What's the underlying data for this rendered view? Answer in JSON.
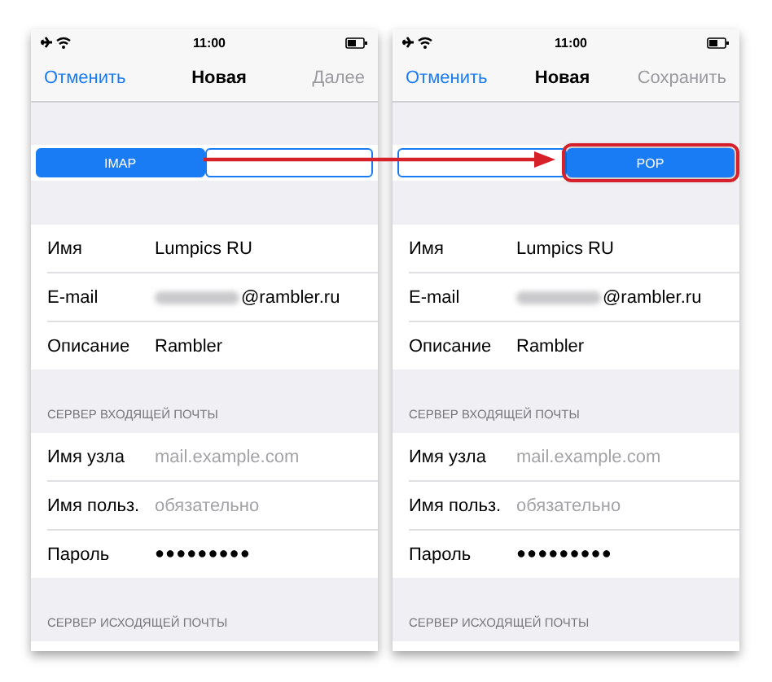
{
  "phones": [
    {
      "time": "11:00",
      "nav": {
        "cancel": "Отменить",
        "title": "Новая",
        "action": "Далее",
        "action_disabled": true
      },
      "segments": [
        {
          "label": "IMAP",
          "selected": true,
          "highlighted": false
        },
        {
          "selected": false,
          "highlighted": false
        }
      ],
      "account_rows": [
        {
          "kind": "text",
          "label": "Имя",
          "value": "Lumpics RU"
        },
        {
          "kind": "email",
          "label": "E-mail",
          "value": "@rambler.ru"
        },
        {
          "kind": "text",
          "label": "Описание",
          "value": "Rambler"
        }
      ],
      "incoming": {
        "header": "СЕРВЕР ВХОДЯЩЕЙ ПОЧТЫ",
        "rows": [
          {
            "kind": "input",
            "label": "Имя узла",
            "placeholder": "mail.example.com"
          },
          {
            "kind": "input",
            "label": "Имя польз.",
            "placeholder": "обязательно"
          },
          {
            "kind": "password",
            "label": "Пароль",
            "value": "●●●●●●●●●"
          }
        ]
      },
      "outgoing_header": "СЕРВЕР ИСХОДЯЩЕЙ ПОЧТЫ"
    },
    {
      "time": "11:00",
      "nav": {
        "cancel": "Отменить",
        "title": "Новая",
        "action": "Сохранить",
        "action_disabled": true
      },
      "segments": [
        {
          "selected": false,
          "highlighted": false
        },
        {
          "label": "POP",
          "selected": true,
          "highlighted": true
        }
      ],
      "account_rows": [
        {
          "kind": "text",
          "label": "Имя",
          "value": "Lumpics RU"
        },
        {
          "kind": "email",
          "label": "E-mail",
          "value": "@rambler.ru"
        },
        {
          "kind": "text",
          "label": "Описание",
          "value": "Rambler"
        }
      ],
      "incoming": {
        "header": "СЕРВЕР ВХОДЯЩЕЙ ПОЧТЫ",
        "rows": [
          {
            "kind": "input",
            "label": "Имя узла",
            "placeholder": "mail.example.com"
          },
          {
            "kind": "input",
            "label": "Имя польз.",
            "placeholder": "обязательно"
          },
          {
            "kind": "password",
            "label": "Пароль",
            "value": "●●●●●●●●●"
          }
        ]
      },
      "outgoing_header": "СЕРВЕР ИСХОДЯЩЕЙ ПОЧТЫ"
    }
  ]
}
